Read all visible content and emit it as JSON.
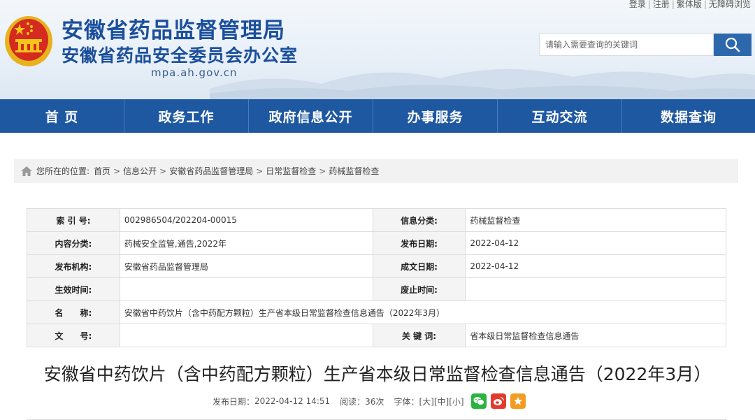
{
  "header": {
    "top_links": [
      "登录",
      "注册",
      "繁体版",
      "无障碍浏览"
    ],
    "title_main": "安徽省药品监督管理局",
    "title_sub": "安徽省药品安全委员会办公室",
    "domain": "mpa.ah.gov.cn",
    "search_placeholder": "请输入需要查询的关键词",
    "colors": {
      "brand_blue": "#1b4f9c",
      "nav_blue": "#1e58a1"
    }
  },
  "nav": {
    "items": [
      {
        "label": "首 页"
      },
      {
        "label": "政务工作"
      },
      {
        "label": "政府信息公开"
      },
      {
        "label": "办事服务"
      },
      {
        "label": "互动交流"
      },
      {
        "label": "数据查询"
      }
    ]
  },
  "breadcrumb": {
    "prefix": "您所在的位置:",
    "items": [
      "首页",
      "信息公开",
      "安徽省药品监督管理局",
      "日常监督检查",
      "药械监督检查"
    ],
    "separator": ">"
  },
  "info_table": {
    "rows": [
      {
        "l1": "索 引 号:",
        "v1": "002986504/202204-00015",
        "l2": "信息分类:",
        "v2": "药械监督检查"
      },
      {
        "l1": "内容分类:",
        "v1": "药械安全监管,通告,2022年",
        "l2": "发布日期:",
        "v2": "2022-04-12"
      },
      {
        "l1": "发布机构:",
        "v1": "安徽省药品监督管理局",
        "l2": "成文日期:",
        "v2": "2022-04-12"
      },
      {
        "l1": "生效时间:",
        "v1": "",
        "l2": "废止时间:",
        "v2": ""
      },
      {
        "l1": "名　　称:",
        "v1": "安徽省中药饮片（含中药配方颗粒）生产省本级日常监督检查信息通告（2022年3月）"
      },
      {
        "l1": "文　　号:",
        "v1": "",
        "l2": "关 键 词:",
        "v2": "省本级日常监督检查信息通告"
      }
    ]
  },
  "article": {
    "title": "安徽省中药饮片（含中药配方颗粒）生产省本级日常监督检查信息通告（2022年3月）",
    "publish_label": "发布日期：",
    "publish_date": "2022-04-12 14:51",
    "views_label": "阅读：",
    "views": "36次",
    "font_label": "字体：",
    "font_sizes": [
      "[大]",
      "[中]",
      "[小]"
    ],
    "share_icons": [
      "wechat-icon",
      "weibo-icon",
      "favorite-icon"
    ]
  }
}
